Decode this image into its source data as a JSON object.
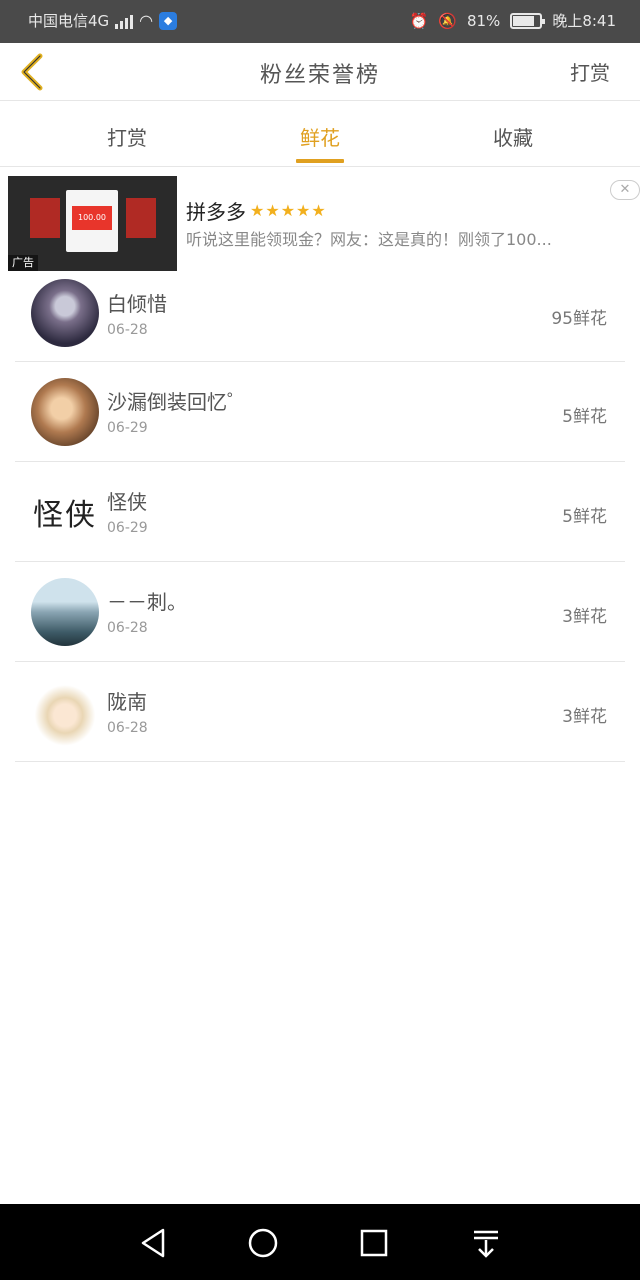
{
  "status_bar": {
    "carrier": "中国电信4G",
    "network": "4G",
    "battery": "81%",
    "battery_level": 0.81,
    "time": "晚上8:41"
  },
  "header": {
    "title": "粉丝荣誉榜",
    "action_label": "打赏"
  },
  "tabs": [
    {
      "label": "打赏",
      "active": false
    },
    {
      "label": "鲜花",
      "active": true
    },
    {
      "label": "收藏",
      "active": false
    }
  ],
  "ad": {
    "tag": "广告",
    "title": "拼多多",
    "stars": "★★★★★",
    "description": "听说这里能领现金？网友：这是真的！刚领了100...",
    "close": "✕",
    "thumb_amount": "100.00"
  },
  "fans": [
    {
      "name": "白倾惜",
      "date": "06-28",
      "flowers": "95鲜花"
    },
    {
      "name": "沙漏倒装回忆゜",
      "date": "06-29",
      "flowers": "5鲜花"
    },
    {
      "name": "怪侠",
      "date": "06-29",
      "flowers": "5鲜花",
      "avatar_text": "怪侠"
    },
    {
      "name": "－－刺。",
      "date": "06-28",
      "flowers": "3鲜花"
    },
    {
      "name": "陇南",
      "date": "06-28",
      "flowers": "3鲜花"
    }
  ],
  "colors": {
    "accent": "#e0a020",
    "status_bar": "#4a4a4a",
    "nav_bar": "#000000"
  }
}
